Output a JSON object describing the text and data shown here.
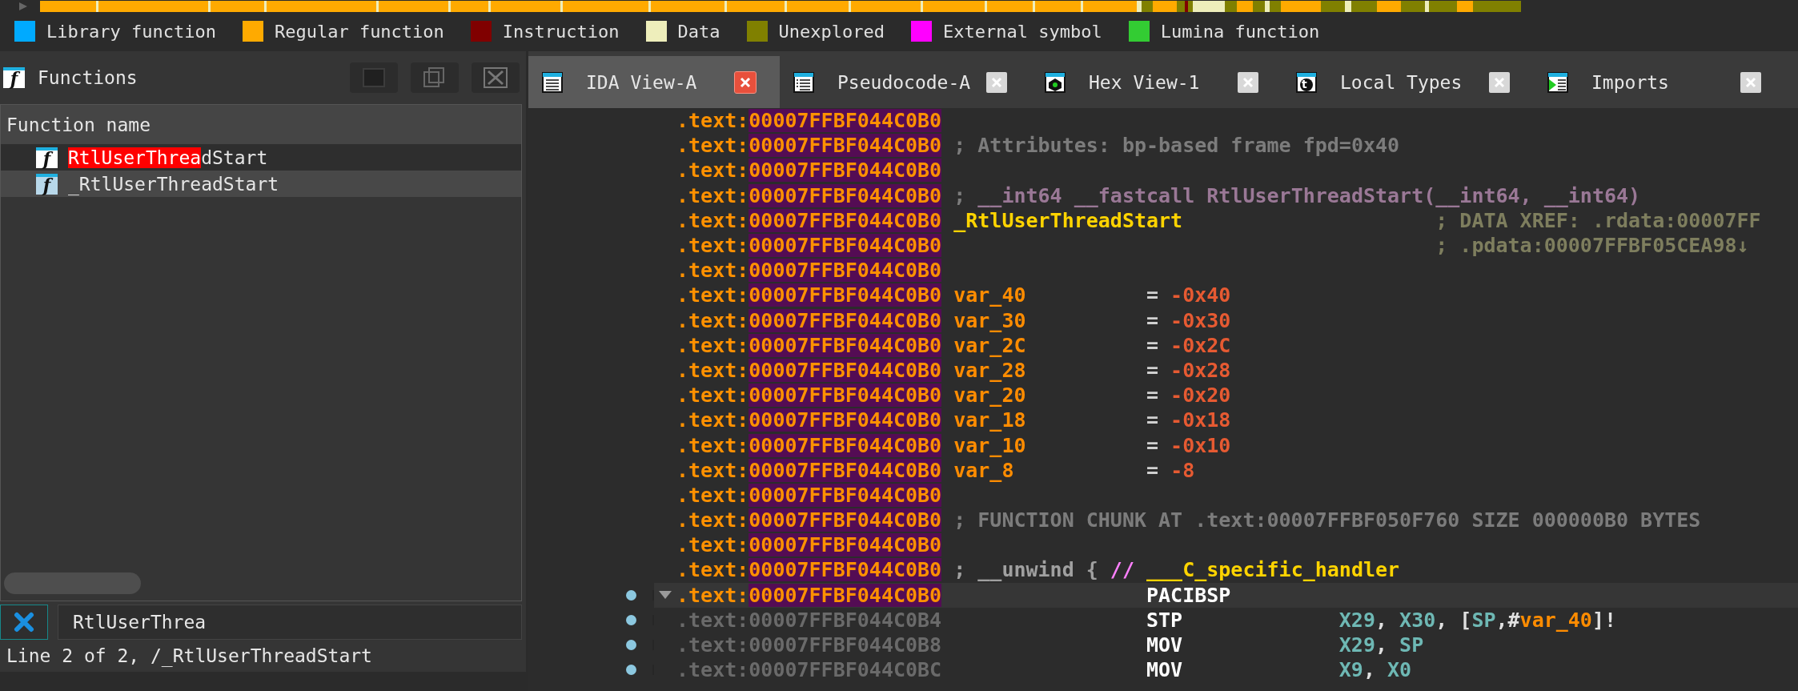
{
  "legend": {
    "items": [
      {
        "label": "Library function",
        "color": "#00aaff"
      },
      {
        "label": "Regular function",
        "color": "#ffaa00"
      },
      {
        "label": "Instruction",
        "color": "#800000"
      },
      {
        "label": "Data",
        "color": "#eeeebb"
      },
      {
        "label": "Unexplored",
        "color": "#808000"
      },
      {
        "label": "External symbol",
        "color": "#ff00ff"
      },
      {
        "label": "Lumina function",
        "color": "#33cc33"
      }
    ]
  },
  "functions_panel": {
    "title": "Functions",
    "icon_glyph": "f",
    "column": "Function name",
    "rows": [
      {
        "icon_glyph": "f",
        "selected": false,
        "name_parts": [
          {
            "text": "RtlUserThrea",
            "matched": true
          },
          {
            "text": "dStart",
            "matched": false
          }
        ]
      },
      {
        "icon_glyph": "f",
        "selected": true,
        "name_parts": [
          {
            "text": "_RtlUserThreadStart",
            "matched": false
          }
        ]
      }
    ],
    "filter": {
      "value": "RtlUserThrea"
    },
    "status": "Line 2 of 2, /_RtlUserThreadStart"
  },
  "tabs": [
    {
      "label": "IDA View-A",
      "kind": "disasm",
      "selected": true
    },
    {
      "label": "Pseudocode-A",
      "kind": "pseudo",
      "selected": false
    },
    {
      "label": "Hex View-1",
      "kind": "hex",
      "selected": false
    },
    {
      "label": "Local Types",
      "kind": "types",
      "icon_glyph": "t",
      "selected": false
    },
    {
      "label": "Imports",
      "kind": "imports",
      "selected": false
    }
  ],
  "lines": [
    {
      "segment": ".text:",
      "address": "00007FFBF044C0B0",
      "highlighted": true,
      "marker": false,
      "collapsible": false,
      "current": false
    },
    {
      "segment": ".text:",
      "address": "00007FFBF044C0B0",
      "highlighted": true,
      "marker": false,
      "collapsible": false,
      "current": false,
      "cells": [
        {
          "kind": "comment",
          "tokens": [
            {
              "text": "; Attributes: bp-based frame fpd=0x40",
              "kind": "comment"
            }
          ]
        }
      ]
    },
    {
      "segment": ".text:",
      "address": "00007FFBF044C0B0",
      "highlighted": true,
      "marker": false,
      "collapsible": false,
      "current": false
    },
    {
      "segment": ".text:",
      "address": "00007FFBF044C0B0",
      "highlighted": true,
      "marker": false,
      "collapsible": false,
      "current": false,
      "cells": [
        {
          "kind": "signature",
          "tokens": [
            {
              "text": "; ",
              "kind": "comment"
            },
            {
              "text": "__int64 __fastcall RtlUserThreadStart(__int64, __int64)",
              "kind": "signature"
            }
          ]
        }
      ]
    },
    {
      "segment": ".text:",
      "address": "00007FFBF044C0B0",
      "highlighted": true,
      "marker": false,
      "collapsible": false,
      "current": false,
      "cells": [
        {
          "kind": "label",
          "tokens": [
            {
              "text": "_RtlUserThreadStart",
              "kind": "name"
            }
          ]
        },
        {
          "kind": "xref",
          "tokens": [
            {
              "text": "; DATA XREF: .rdata:00007FF",
              "kind": "xref"
            }
          ]
        }
      ]
    },
    {
      "segment": ".text:",
      "address": "00007FFBF044C0B0",
      "highlighted": true,
      "marker": false,
      "collapsible": false,
      "current": false,
      "cells": [
        {
          "kind": "xref",
          "tokens": [
            {
              "text": "; .pdata:00007FFBF05CEA98↓",
              "kind": "xref"
            }
          ]
        }
      ]
    },
    {
      "segment": ".text:",
      "address": "00007FFBF044C0B0",
      "highlighted": true,
      "marker": false,
      "collapsible": false,
      "current": false
    },
    {
      "segment": ".text:",
      "address": "00007FFBF044C0B0",
      "highlighted": true,
      "marker": false,
      "collapsible": false,
      "current": false,
      "cells": [
        {
          "kind": "var",
          "tokens": [
            {
              "text": "var_40",
              "kind": "var"
            }
          ]
        },
        {
          "kind": "assign",
          "tokens": [
            {
              "text": "= ",
              "kind": "eq"
            },
            {
              "text": "-0x40",
              "kind": "num"
            }
          ]
        }
      ]
    },
    {
      "segment": ".text:",
      "address": "00007FFBF044C0B0",
      "highlighted": true,
      "marker": false,
      "collapsible": false,
      "current": false,
      "cells": [
        {
          "kind": "var",
          "tokens": [
            {
              "text": "var_30",
              "kind": "var"
            }
          ]
        },
        {
          "kind": "assign",
          "tokens": [
            {
              "text": "= ",
              "kind": "eq"
            },
            {
              "text": "-0x30",
              "kind": "num"
            }
          ]
        }
      ]
    },
    {
      "segment": ".text:",
      "address": "00007FFBF044C0B0",
      "highlighted": true,
      "marker": false,
      "collapsible": false,
      "current": false,
      "cells": [
        {
          "kind": "var",
          "tokens": [
            {
              "text": "var_2C",
              "kind": "var"
            }
          ]
        },
        {
          "kind": "assign",
          "tokens": [
            {
              "text": "= ",
              "kind": "eq"
            },
            {
              "text": "-0x2C",
              "kind": "num"
            }
          ]
        }
      ]
    },
    {
      "segment": ".text:",
      "address": "00007FFBF044C0B0",
      "highlighted": true,
      "marker": false,
      "collapsible": false,
      "current": false,
      "cells": [
        {
          "kind": "var",
          "tokens": [
            {
              "text": "var_28",
              "kind": "var"
            }
          ]
        },
        {
          "kind": "assign",
          "tokens": [
            {
              "text": "= ",
              "kind": "eq"
            },
            {
              "text": "-0x28",
              "kind": "num"
            }
          ]
        }
      ]
    },
    {
      "segment": ".text:",
      "address": "00007FFBF044C0B0",
      "highlighted": true,
      "marker": false,
      "collapsible": false,
      "current": false,
      "cells": [
        {
          "kind": "var",
          "tokens": [
            {
              "text": "var_20",
              "kind": "var"
            }
          ]
        },
        {
          "kind": "assign",
          "tokens": [
            {
              "text": "= ",
              "kind": "eq"
            },
            {
              "text": "-0x20",
              "kind": "num"
            }
          ]
        }
      ]
    },
    {
      "segment": ".text:",
      "address": "00007FFBF044C0B0",
      "highlighted": true,
      "marker": false,
      "collapsible": false,
      "current": false,
      "cells": [
        {
          "kind": "var",
          "tokens": [
            {
              "text": "var_18",
              "kind": "var"
            }
          ]
        },
        {
          "kind": "assign",
          "tokens": [
            {
              "text": "= ",
              "kind": "eq"
            },
            {
              "text": "-0x18",
              "kind": "num"
            }
          ]
        }
      ]
    },
    {
      "segment": ".text:",
      "address": "00007FFBF044C0B0",
      "highlighted": true,
      "marker": false,
      "collapsible": false,
      "current": false,
      "cells": [
        {
          "kind": "var",
          "tokens": [
            {
              "text": "var_10",
              "kind": "var"
            }
          ]
        },
        {
          "kind": "assign",
          "tokens": [
            {
              "text": "= ",
              "kind": "eq"
            },
            {
              "text": "-0x10",
              "kind": "num"
            }
          ]
        }
      ]
    },
    {
      "segment": ".text:",
      "address": "00007FFBF044C0B0",
      "highlighted": true,
      "marker": false,
      "collapsible": false,
      "current": false,
      "cells": [
        {
          "kind": "var",
          "tokens": [
            {
              "text": "var_8",
              "kind": "var"
            }
          ]
        },
        {
          "kind": "assign",
          "tokens": [
            {
              "text": "= ",
              "kind": "eq"
            },
            {
              "text": "-8",
              "kind": "num"
            }
          ]
        }
      ]
    },
    {
      "segment": ".text:",
      "address": "00007FFBF044C0B0",
      "highlighted": true,
      "marker": false,
      "collapsible": false,
      "current": false
    },
    {
      "segment": ".text:",
      "address": "00007FFBF044C0B0",
      "highlighted": true,
      "marker": false,
      "collapsible": false,
      "current": false,
      "cells": [
        {
          "kind": "comment",
          "tokens": [
            {
              "text": "; FUNCTION CHUNK AT .text:00007FFBF050F760 SIZE 000000B0 BYTES",
              "kind": "comment"
            }
          ]
        }
      ]
    },
    {
      "segment": ".text:",
      "address": "00007FFBF044C0B0",
      "highlighted": true,
      "marker": false,
      "collapsible": false,
      "current": false
    },
    {
      "segment": ".text:",
      "address": "00007FFBF044C0B0",
      "highlighted": true,
      "marker": false,
      "collapsible": false,
      "current": false,
      "cells": [
        {
          "kind": "annotation",
          "tokens": [
            {
              "text": "; __unwind { ",
              "kind": "comment"
            },
            {
              "text": "// ",
              "kind": "pink"
            },
            {
              "text": "___C_specific_handler",
              "kind": "name"
            }
          ]
        }
      ]
    },
    {
      "segment": ".text:",
      "address": "00007FFBF044C0B0",
      "highlighted": true,
      "marker": true,
      "collapsible": true,
      "current": true,
      "cells": [
        {
          "kind": "mnemonic",
          "tokens": [
            {
              "text": "PACIBSP",
              "kind": "mnemonic"
            }
          ]
        }
      ]
    },
    {
      "segment": ".text:",
      "address": "00007FFBF044C0B4",
      "highlighted": false,
      "marker": true,
      "collapsible": false,
      "current": false,
      "cells": [
        {
          "kind": "mnemonic",
          "tokens": [
            {
              "text": "STP",
              "kind": "mnemonic"
            }
          ]
        },
        {
          "kind": "operands",
          "tokens": [
            {
              "text": "X29",
              "kind": "reg"
            },
            {
              "text": ", ",
              "kind": "punct"
            },
            {
              "text": "X30",
              "kind": "reg"
            },
            {
              "text": ", [",
              "kind": "punct"
            },
            {
              "text": "SP",
              "kind": "reg"
            },
            {
              "text": ",#",
              "kind": "punct"
            },
            {
              "text": "var_40",
              "kind": "var"
            },
            {
              "text": "]!",
              "kind": "punct"
            }
          ]
        }
      ]
    },
    {
      "segment": ".text:",
      "address": "00007FFBF044C0B8",
      "highlighted": false,
      "marker": true,
      "collapsible": false,
      "current": false,
      "cells": [
        {
          "kind": "mnemonic",
          "tokens": [
            {
              "text": "MOV",
              "kind": "mnemonic"
            }
          ]
        },
        {
          "kind": "operands",
          "tokens": [
            {
              "text": "X29",
              "kind": "reg"
            },
            {
              "text": ", ",
              "kind": "punct"
            },
            {
              "text": "SP",
              "kind": "reg"
            }
          ]
        }
      ]
    },
    {
      "segment": ".text:",
      "address": "00007FFBF044C0BC",
      "highlighted": false,
      "marker": true,
      "collapsible": false,
      "current": false,
      "cells": [
        {
          "kind": "mnemonic",
          "tokens": [
            {
              "text": "MOV",
              "kind": "mnemonic"
            }
          ]
        },
        {
          "kind": "operands",
          "tokens": [
            {
              "text": "X9",
              "kind": "reg"
            },
            {
              "text": ", ",
              "kind": "punct"
            },
            {
              "text": "X0",
              "kind": "reg"
            }
          ]
        }
      ]
    }
  ]
}
